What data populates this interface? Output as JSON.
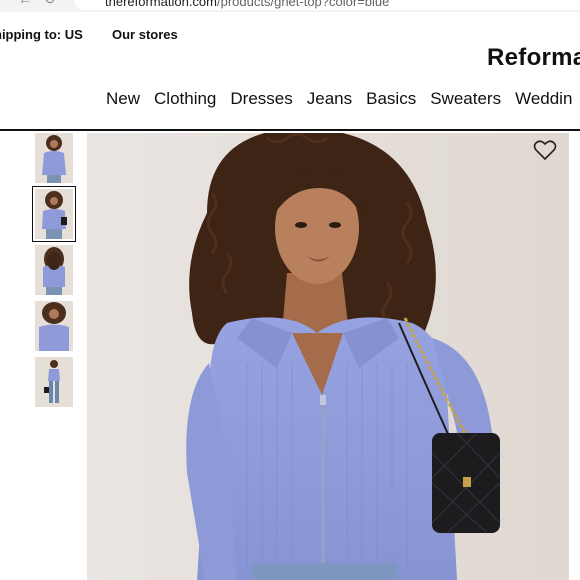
{
  "browser": {
    "url_host": "thereformation.com",
    "url_path": "/products/ghet-top?color=blue"
  },
  "utility": {
    "shipping": "hipping to: US",
    "stores": "Our stores"
  },
  "logo": "Reforma",
  "nav": {
    "items": [
      "New",
      "Clothing",
      "Dresses",
      "Jeans",
      "Basics",
      "Sweaters",
      "Weddin"
    ]
  },
  "product": {
    "color": "#8f9bd9",
    "thumbnail_count": 5,
    "selected_thumbnail_index": 1
  },
  "icons": {
    "wishlist": "heart-icon",
    "back": "arrow-left-icon",
    "reload": "reload-icon"
  }
}
